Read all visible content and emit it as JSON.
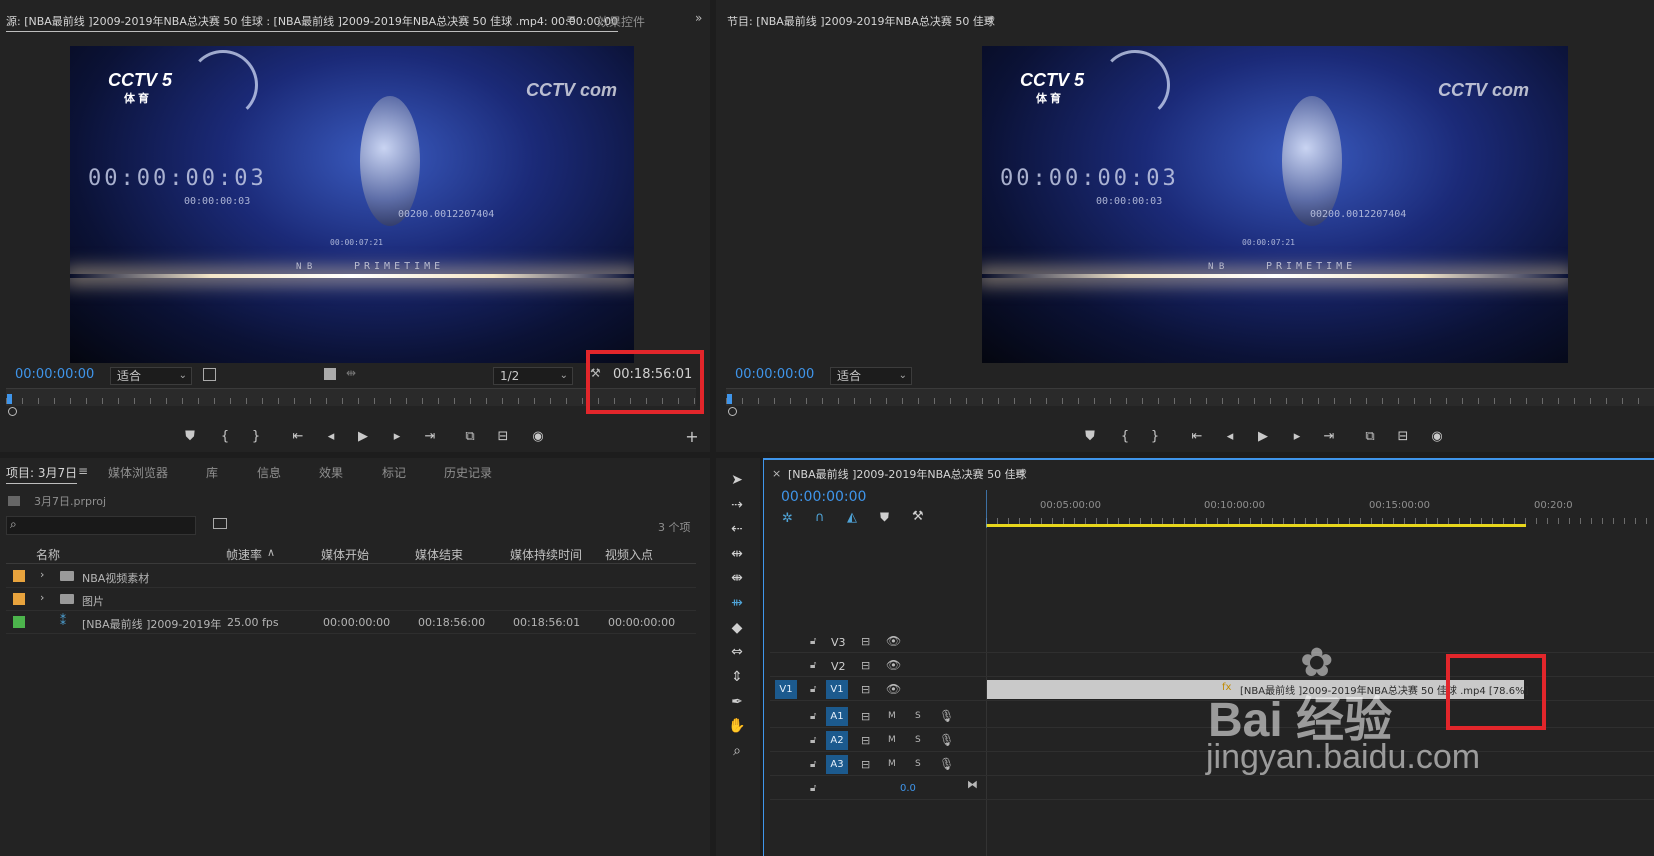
{
  "source_monitor": {
    "title": "源: [NBA最前线 ]2009-2019年NBA总决赛 50 佳球 : [NBA最前线 ]2009-2019年NBA总决赛 50 佳球 .mp4: 00:00:00:00",
    "menu_icon": "hamburger-icon",
    "tab_effects": "效果控件",
    "expand_icon": "double-chevron-right-icon",
    "timecode_current": "00:00:00:00",
    "fit_select": "适合",
    "resolution_select": "1/2",
    "timecode_duration": "00:18:56:01"
  },
  "program_monitor": {
    "title": "节目: [NBA最前线 ]2009-2019年NBA总决赛 50 佳球",
    "menu_icon": "hamburger-icon",
    "timecode_current": "00:00:00:00",
    "fit_select": "适合"
  },
  "video_frame": {
    "channel_logo": "CCTV 5",
    "channel_sub": "体 育",
    "watermark": "CCTV com",
    "big_timecode": "00:00:00:03",
    "small_timecode": "00:00:00:03",
    "code_line": "00200.0012207404",
    "code_line2": "00:00:07:21",
    "brand_left": "N B",
    "brand_right": "PRIMETIME"
  },
  "project_panel": {
    "tabs": [
      "项目: 3月7日",
      "媒体浏览器",
      "库",
      "信息",
      "效果",
      "标记",
      "历史记录"
    ],
    "file_name": "3月7日.prproj",
    "item_count": "3 个项",
    "columns": [
      "名称",
      "帧速率",
      "媒体开始",
      "媒体结束",
      "媒体持续时间",
      "视频入点"
    ],
    "rows": [
      {
        "color": "#e8a33d",
        "name": "NBA视频素材",
        "type": "folder",
        "fps": "",
        "start": "",
        "end": "",
        "duration": "",
        "in": ""
      },
      {
        "color": "#e8a33d",
        "name": "图片",
        "type": "folder",
        "fps": "",
        "start": "",
        "end": "",
        "duration": "",
        "in": ""
      },
      {
        "color": "#4cb44c",
        "name": "[NBA最前线 ]2009-2019年",
        "type": "sequence",
        "fps": "25.00 fps",
        "start": "00:00:00:00",
        "end": "00:18:56:00",
        "duration": "00:18:56:01",
        "in": "00:00:00:00"
      }
    ]
  },
  "timeline": {
    "tab_title": "[NBA最前线 ]2009-2019年NBA总决赛 50 佳球",
    "timecode": "00:00:00:00",
    "ruler_labels": [
      "00:05:00:00",
      "00:10:00:00",
      "00:15:00:00",
      "00:20:0"
    ],
    "tracks": [
      {
        "name": "V3",
        "kind": "video",
        "source": ""
      },
      {
        "name": "V2",
        "kind": "video",
        "source": ""
      },
      {
        "name": "V1",
        "kind": "video",
        "source": "V1"
      },
      {
        "name": "A1",
        "kind": "audio",
        "source": ""
      },
      {
        "name": "A2",
        "kind": "audio",
        "source": ""
      },
      {
        "name": "A3",
        "kind": "audio",
        "source": ""
      }
    ],
    "mute_label": "M",
    "solo_label": "S",
    "clip_label": "[NBA最前线 ]2009-2019年NBA总决赛 50 佳球 .mp4 [78.6%]",
    "master_volume": "0.0"
  },
  "watermark": {
    "brand": "Bai 经验",
    "url": "jingyan.baidu.com"
  },
  "colors": {
    "accent_blue": "#3f95ea",
    "highlight_red": "#e2262b",
    "track_blue": "#1c5a8e"
  }
}
